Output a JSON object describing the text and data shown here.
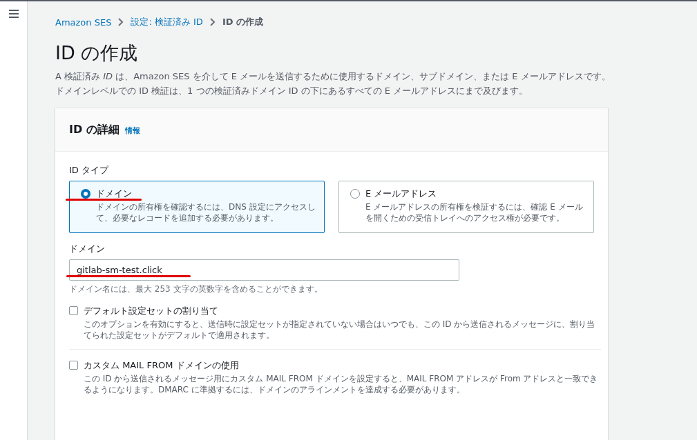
{
  "breadcrumbs": [
    {
      "label": "Amazon SES",
      "current": false
    },
    {
      "label": "設定: 検証済み ID",
      "current": false
    },
    {
      "label": "ID の作成",
      "current": true
    }
  ],
  "page_title": "ID の作成",
  "description": "A 検証済み *ID* は、Amazon SES を介して E メールを送信するために使用するドメイン、サブドメイン、または E メールアドレスです。ドメインレベルでの ID 検証は、1 つの検証済みドメイン ID の下にあるすべての E メールアドレスにまで及びます。",
  "card": {
    "title": "ID の詳細",
    "info_link": "情報",
    "id_type": {
      "label": "ID タイプ",
      "options": [
        {
          "label": "ドメイン",
          "description": "ドメインの所有権を確認するには、DNS 設定にアクセスして、必要なレコードを追加する必要があります。",
          "selected": true,
          "underlined": true
        },
        {
          "label": "E メールアドレス",
          "description": "E メールアドレスの所有権を検証するには、確認 E メールを開くための受信トレイへのアクセス権が必要です。",
          "selected": false,
          "underlined": false
        }
      ]
    },
    "domain": {
      "label": "ドメイン",
      "value": "gitlab-sm-test.click",
      "hint": "ドメイン名には、最大 253 文字の英数字を含めることができます。",
      "underlined": true
    },
    "options": [
      {
        "label": "デフォルト設定セットの割り当て",
        "description": "このオプションを有効にすると、送信時に設定セットが指定されていない場合はいつでも、この ID から送信されるメッセージに、割り当てられた設定セットがデフォルトで適用されます。",
        "checked": false
      },
      {
        "label": "カスタム MAIL FROM ドメインの使用",
        "description": "この ID から送信されるメッセージ用にカスタム MAIL FROM ドメインを設定すると、MAIL FROM アドレスが From アドレスと一致できるようになります。DMARC に準拠するには、ドメインのアラインメントを達成する必要があります。",
        "checked": false
      }
    ]
  }
}
